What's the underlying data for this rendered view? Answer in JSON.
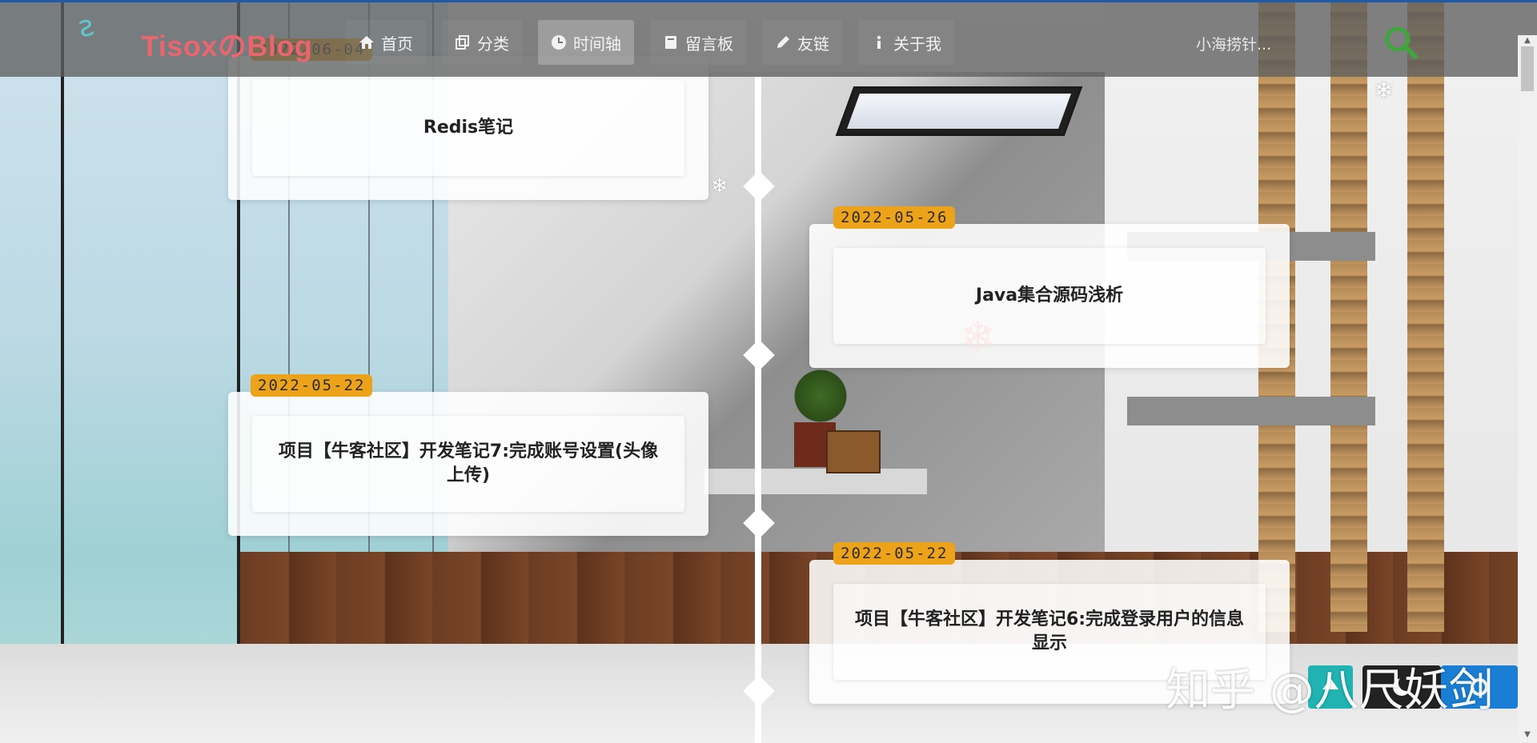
{
  "header": {
    "brand": "TisoxのBlog",
    "nav": [
      {
        "label": "首页",
        "icon": "home-icon"
      },
      {
        "label": "分类",
        "icon": "copy-icon"
      },
      {
        "label": "时间轴",
        "icon": "clock-icon",
        "active": true
      },
      {
        "label": "留言板",
        "icon": "book-icon"
      },
      {
        "label": "友链",
        "icon": "pencil-icon"
      },
      {
        "label": "关于我",
        "icon": "info-icon"
      }
    ],
    "site_search_text": "小海捞针...",
    "search_icon": "search-icon",
    "accent_color": "#3fa53f"
  },
  "timeline": {
    "posts": [
      {
        "date": "2022-06-04",
        "title": "Redis笔记",
        "side": "left"
      },
      {
        "date": "2022-05-26",
        "title": "Java集合源码浅析",
        "side": "right"
      },
      {
        "date": "2022-05-22",
        "title": "项目【牛客社区】开发笔记7:完成账号设置(头像上传)",
        "side": "left"
      },
      {
        "date": "2022-05-22",
        "title": "项目【牛客社区】开发笔记6:完成登录用户的信息显示",
        "side": "right"
      }
    ],
    "badge_color": "#eca31a"
  },
  "watermark": "知乎 @八尺妖剑",
  "floating_buttons": [
    {
      "icon": "up-icon",
      "color": "#21b2b2"
    },
    {
      "icon": "moon-icon",
      "color": "#222222"
    },
    {
      "icon": "settings-icon",
      "color": "#1a7fd4"
    }
  ]
}
